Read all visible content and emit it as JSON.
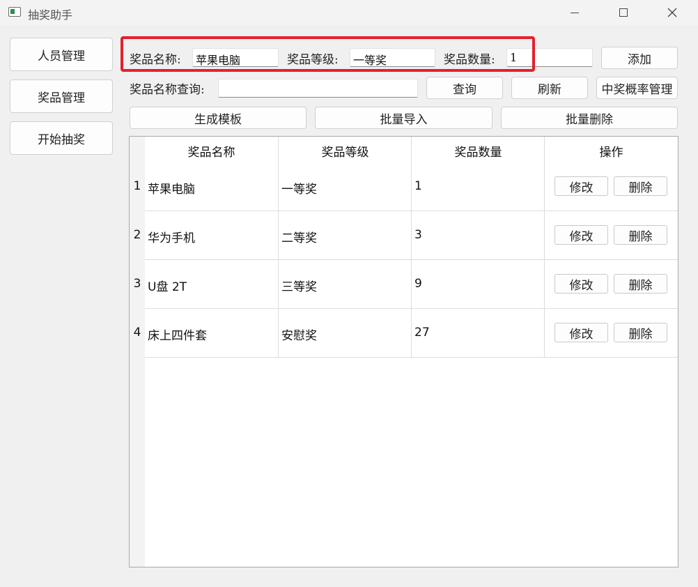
{
  "window": {
    "title": "抽奖助手"
  },
  "nav": [
    "人员管理",
    "奖品管理",
    "开始抽奖"
  ],
  "form": {
    "name_label": "奖品名称:",
    "name_value": "苹果电脑",
    "level_label": "奖品等级:",
    "level_value": "一等奖",
    "count_label": "奖品数量:",
    "count_value": "1",
    "add_button": "添加"
  },
  "search": {
    "label": "奖品名称查询:",
    "value": "",
    "query_button": "查询",
    "refresh_button": "刷新",
    "probability_button": "中奖概率管理"
  },
  "toolbar": {
    "template_button": "生成模板",
    "import_button": "批量导入",
    "delete_button": "批量删除"
  },
  "table": {
    "columns": [
      "奖品名称",
      "奖品等级",
      "奖品数量",
      "操作"
    ],
    "rows": [
      {
        "num": "1",
        "name": "苹果电脑",
        "level": "一等奖",
        "count": "1"
      },
      {
        "num": "2",
        "name": "华为手机",
        "level": "二等奖",
        "count": "3"
      },
      {
        "num": "3",
        "name": "U盘 2T",
        "level": "三等奖",
        "count": "9"
      },
      {
        "num": "4",
        "name": "床上四件套",
        "level": "安慰奖",
        "count": "27"
      }
    ],
    "edit_label": "修改",
    "delete_label": "删除"
  },
  "colors": {
    "highlight": "#e4202e"
  }
}
